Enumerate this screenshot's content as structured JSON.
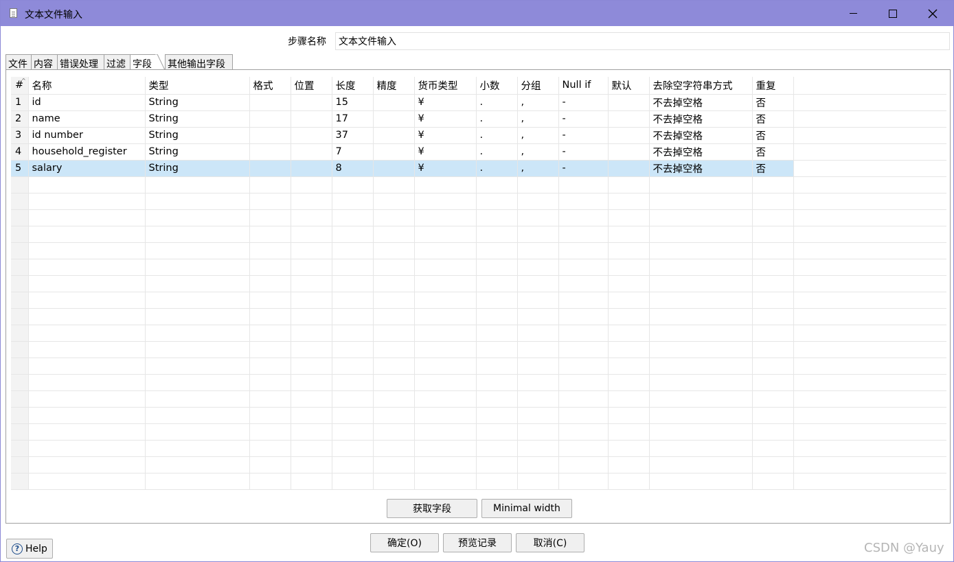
{
  "window": {
    "title": "文本文件输入"
  },
  "step": {
    "label": "步骤名称",
    "value": "文本文件输入"
  },
  "tabs": [
    {
      "label": "文件",
      "active": false
    },
    {
      "label": "内容",
      "active": false
    },
    {
      "label": "错误处理",
      "active": false
    },
    {
      "label": "过滤",
      "active": false
    },
    {
      "label": "字段",
      "active": true
    },
    {
      "label": "其他输出字段",
      "active": false
    }
  ],
  "table": {
    "headers": [
      "#",
      "名称",
      "类型",
      "格式",
      "位置",
      "长度",
      "精度",
      "货币类型",
      "小数",
      "分组",
      "Null if",
      "默认",
      "去除空字符串方式",
      "重复"
    ],
    "rows": [
      [
        "1",
        "id",
        "String",
        "",
        "",
        "15",
        "",
        "¥",
        ".",
        ",",
        "-",
        "",
        "不去掉空格",
        "否"
      ],
      [
        "2",
        "name",
        "String",
        "",
        "",
        "17",
        "",
        "¥",
        ".",
        ",",
        "-",
        "",
        "不去掉空格",
        "否"
      ],
      [
        "3",
        "id number",
        "String",
        "",
        "",
        "37",
        "",
        "¥",
        ".",
        ",",
        "-",
        "",
        "不去掉空格",
        "否"
      ],
      [
        "4",
        "household_register",
        "String",
        "",
        "",
        "7",
        "",
        "¥",
        ".",
        ",",
        "-",
        "",
        "不去掉空格",
        "否"
      ],
      [
        "5",
        "salary",
        "String",
        "",
        "",
        "8",
        "",
        "¥",
        ".",
        ",",
        "-",
        "",
        "不去掉空格",
        "否"
      ]
    ],
    "selected_row": 5,
    "selection_color": "#cce6f8"
  },
  "buttons": {
    "get_fields": "获取字段",
    "minimal_width": "Minimal width",
    "ok": "确定(O)",
    "preview": "预览记录",
    "cancel": "取消(C)",
    "help": "Help"
  },
  "watermark": "CSDN @Yauy",
  "colors": {
    "titlebar": "#8e8ad9",
    "selection": "#cce6f8"
  }
}
